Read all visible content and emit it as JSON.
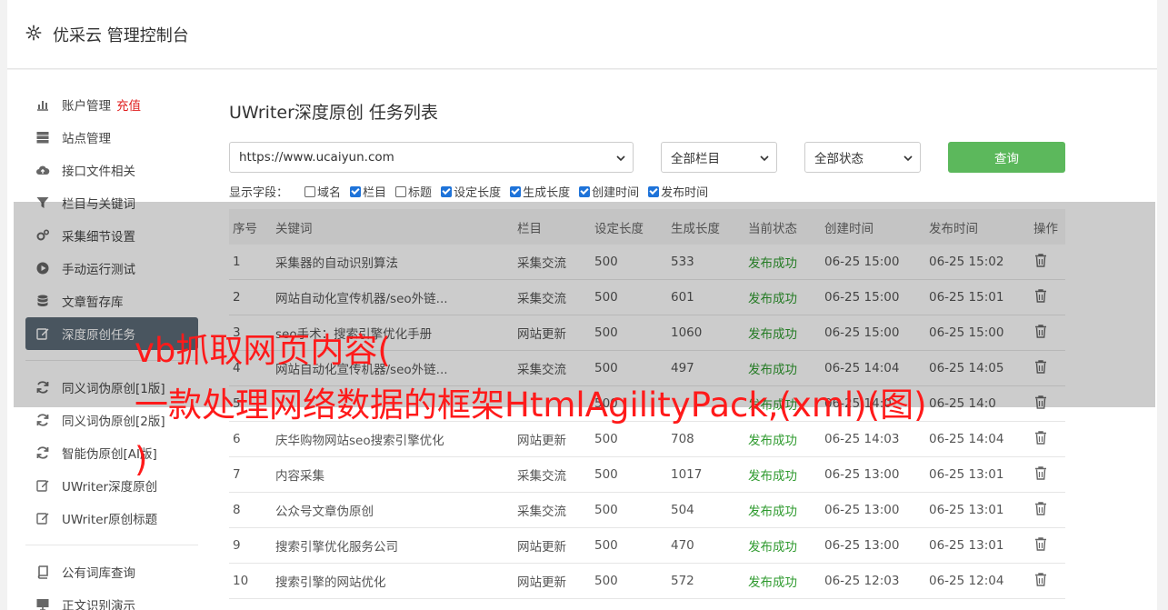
{
  "header": {
    "title": "优采云 管理控制台",
    "icon": "gear-icon"
  },
  "sidebar": {
    "groups": [
      [
        {
          "label": "账户管理",
          "badge": "充值",
          "icon": "bar-chart-icon"
        },
        {
          "label": "站点管理",
          "icon": "server-icon"
        },
        {
          "label": "接口文件相关",
          "icon": "cloud-upload-icon"
        },
        {
          "label": "栏目与关键词",
          "icon": "filter-icon"
        },
        {
          "label": "采集细节设置",
          "icon": "gears-icon"
        },
        {
          "label": "手动运行测试",
          "icon": "play-circle-icon"
        },
        {
          "label": "文章暂存库",
          "icon": "database-icon"
        },
        {
          "label": "深度原创任务",
          "icon": "edit-icon",
          "active": true
        }
      ],
      [
        {
          "label": "同义词伪原创[1版]",
          "icon": "refresh-icon"
        },
        {
          "label": "同义词伪原创[2版]",
          "icon": "refresh-icon"
        },
        {
          "label": "智能伪原创[AI版]",
          "icon": "refresh-icon"
        },
        {
          "label": "UWriter深度原创",
          "icon": "edit-icon"
        },
        {
          "label": "UWriter原创标题",
          "icon": "edit-icon"
        }
      ],
      [
        {
          "label": "公有词库查询",
          "icon": "book-icon"
        },
        {
          "label": "正文识别演示",
          "icon": "monitor-icon"
        }
      ]
    ]
  },
  "main": {
    "title": "UWriter深度原创 任务列表",
    "site_select": "https://www.ucaiyun.com",
    "column_select": "全部栏目",
    "status_select": "全部状态",
    "query_label": "查询",
    "fields_label": "显示字段：",
    "fields": [
      {
        "label": "域名",
        "checked": false
      },
      {
        "label": "栏目",
        "checked": true
      },
      {
        "label": "标题",
        "checked": false
      },
      {
        "label": "设定长度",
        "checked": true
      },
      {
        "label": "生成长度",
        "checked": true
      },
      {
        "label": "创建时间",
        "checked": true
      },
      {
        "label": "发布时间",
        "checked": true
      }
    ],
    "columns": [
      "序号",
      "关键词",
      "栏目",
      "设定长度",
      "生成长度",
      "当前状态",
      "创建时间",
      "发布时间",
      "操作"
    ],
    "rows": [
      [
        "1",
        "采集器的自动识别算法",
        "采集交流",
        "500",
        "533",
        "发布成功",
        "06-25 15:00",
        "06-25 15:02"
      ],
      [
        "2",
        "网站自动化宣传机器/seo外链...",
        "采集交流",
        "500",
        "601",
        "发布成功",
        "06-25 15:00",
        "06-25 15:01"
      ],
      [
        "3",
        "seo手术：搜索引擎优化手册",
        "网站更新",
        "500",
        "1060",
        "发布成功",
        "06-25 15:00",
        "06-25 15:00"
      ],
      [
        "4",
        "网站自动化宣传机器/seo外链...",
        "采集交流",
        "500",
        "497",
        "发布成功",
        "06-25 14:04",
        "06-25 14:05"
      ],
      [
        "5",
        "",
        "",
        "500",
        "",
        "发布成功",
        "06-25 14:0",
        "06-25 14:0"
      ],
      [
        "6",
        "庆华购物网站seo搜索引擎优化",
        "网站更新",
        "500",
        "708",
        "发布成功",
        "06-25 14:03",
        "06-25 14:04"
      ],
      [
        "7",
        "内容采集",
        "采集交流",
        "500",
        "1017",
        "发布成功",
        "06-25 13:00",
        "06-25 13:01"
      ],
      [
        "8",
        "公众号文章伪原创",
        "采集交流",
        "500",
        "504",
        "发布成功",
        "06-25 13:00",
        "06-25 13:01"
      ],
      [
        "9",
        "搜索引擎优化服务公司",
        "网站更新",
        "500",
        "470",
        "发布成功",
        "06-25 13:00",
        "06-25 13:01"
      ],
      [
        "10",
        "搜索引擎的网站优化",
        "网站更新",
        "500",
        "572",
        "发布成功",
        "06-25 12:03",
        "06-25 12:04"
      ]
    ]
  },
  "watermark": {
    "line1": "vb抓取网页内容(",
    "line2": "一款处理网络数据的框架HtmlAgilityPack,(xml)(图)",
    "line3": ")"
  },
  "colors": {
    "active": "#5c6b77",
    "query": "#5cb85c",
    "success": "#2e9a2e",
    "badge": "#e02020",
    "watermark": "#ff1a1a"
  }
}
